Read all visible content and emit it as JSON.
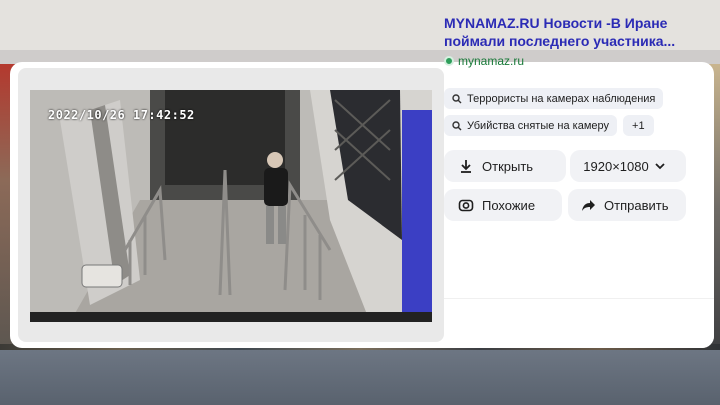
{
  "camera": {
    "timestamp": "2022/10/26 17:42:52"
  },
  "result": {
    "title": "MYNAMAZ.RU Новости -В Иране поймали последнего участника...",
    "site": "mynamaz.ru"
  },
  "tags": [
    {
      "label": "Террористы на камерах наблюдения",
      "icon": "search-icon"
    },
    {
      "label": "Убийства снятые на камеру",
      "icon": "search-icon"
    },
    {
      "label": "+1"
    }
  ],
  "actions": {
    "open_label": "Открыть",
    "size_label": "1920×1080",
    "similar_label": "Похожие",
    "share_label": "Отправить"
  },
  "colors": {
    "title": "#2b2bb5",
    "site": "#1a7a3a",
    "button_bg": "#f1f2f5",
    "tag_bg": "#eef0f5"
  }
}
